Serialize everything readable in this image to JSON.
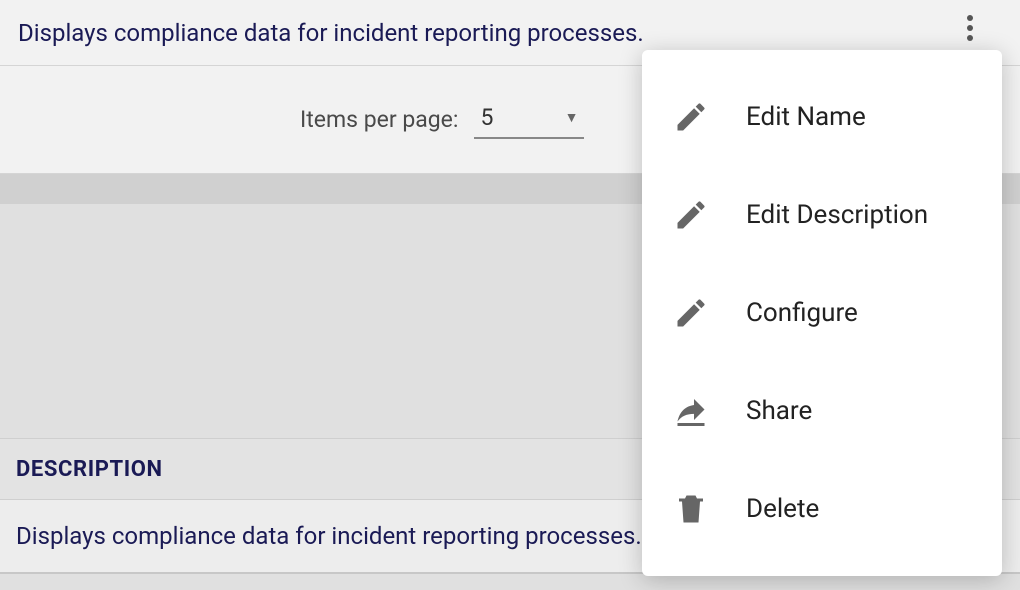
{
  "top_description": "Displays compliance data for incident reporting processes.",
  "pagination": {
    "label": "Items per page:",
    "value": "5"
  },
  "description_heading": "DESCRIPTION",
  "bottom_description": "Displays compliance data for incident reporting processes.",
  "menu": {
    "items": [
      {
        "icon": "pencil",
        "label": "Edit Name"
      },
      {
        "icon": "pencil",
        "label": "Edit Description"
      },
      {
        "icon": "pencil",
        "label": "Configure"
      },
      {
        "icon": "share",
        "label": "Share"
      },
      {
        "icon": "trash",
        "label": "Delete"
      }
    ]
  }
}
